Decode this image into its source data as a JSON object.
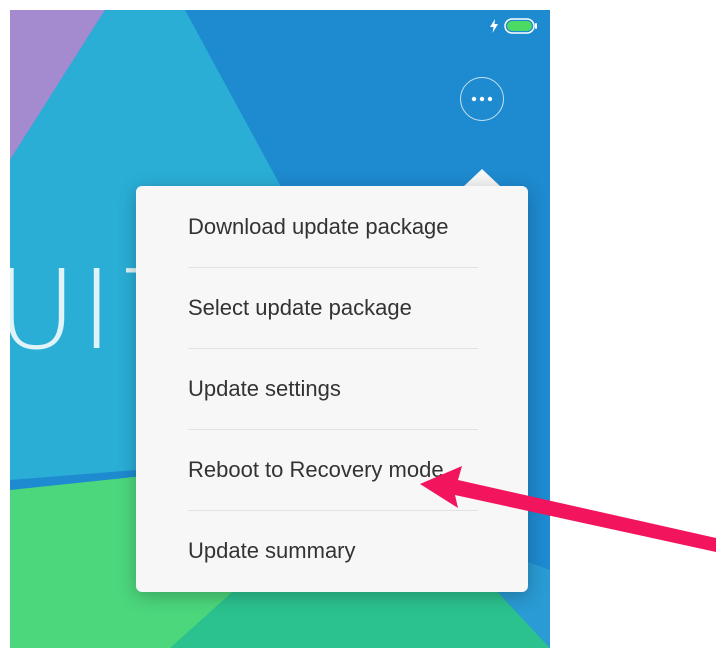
{
  "status_bar": {
    "charging_icon": "lightning-bolt-icon",
    "battery_icon": "battery-full-icon",
    "battery_color": "#4cd964"
  },
  "header": {
    "more_button_icon": "more-dots-icon"
  },
  "background": {
    "logo_text": "UI7",
    "colors": {
      "blue": "#1e8ad0",
      "cyan": "#2aaed6",
      "purple": "#a48bd0",
      "green": "#4cd77c",
      "teal": "#2bc28f"
    }
  },
  "menu": {
    "items": [
      {
        "label": "Download update package"
      },
      {
        "label": "Select update package"
      },
      {
        "label": "Update settings"
      },
      {
        "label": "Reboot to Recovery mode"
      },
      {
        "label": "Update summary"
      }
    ]
  },
  "annotation": {
    "arrow_color": "#f2145c",
    "arrow_icon": "pointer-arrow-icon"
  }
}
